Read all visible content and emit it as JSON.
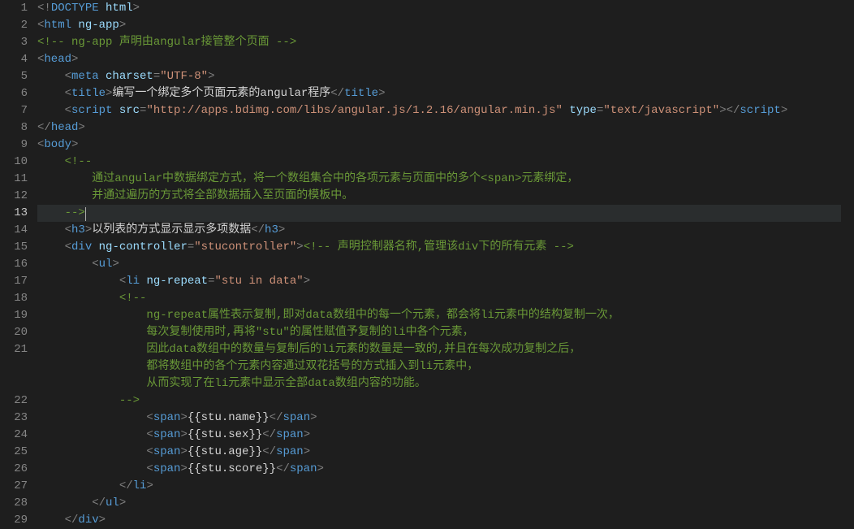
{
  "active_line": 13,
  "lines": [
    {
      "n": 1,
      "indent": 0,
      "tokens": [
        {
          "c": "p-delim",
          "t": "<!"
        },
        {
          "c": "p-tag",
          "t": "DOCTYPE"
        },
        {
          "c": "p-attr",
          "t": " html"
        },
        {
          "c": "p-delim",
          "t": ">"
        }
      ]
    },
    {
      "n": 2,
      "indent": 0,
      "tokens": [
        {
          "c": "p-delim",
          "t": "<"
        },
        {
          "c": "p-tag",
          "t": "html"
        },
        {
          "c": "p-attr",
          "t": " ng-app"
        },
        {
          "c": "p-delim",
          "t": ">"
        }
      ]
    },
    {
      "n": 3,
      "indent": 0,
      "tokens": [
        {
          "c": "p-comment",
          "t": "<!-- ng-app 声明由angular接管整个页面 -->"
        }
      ]
    },
    {
      "n": 4,
      "indent": 0,
      "tokens": [
        {
          "c": "p-delim",
          "t": "<"
        },
        {
          "c": "p-tag",
          "t": "head"
        },
        {
          "c": "p-delim",
          "t": ">"
        }
      ]
    },
    {
      "n": 5,
      "indent": 1,
      "tokens": [
        {
          "c": "p-delim",
          "t": "<"
        },
        {
          "c": "p-tag",
          "t": "meta"
        },
        {
          "c": "p-attr",
          "t": " charset"
        },
        {
          "c": "p-delim",
          "t": "="
        },
        {
          "c": "p-str",
          "t": "\"UTF-8\""
        },
        {
          "c": "p-delim",
          "t": ">"
        }
      ]
    },
    {
      "n": 6,
      "indent": 1,
      "tokens": [
        {
          "c": "p-delim",
          "t": "<"
        },
        {
          "c": "p-tag",
          "t": "title"
        },
        {
          "c": "p-delim",
          "t": ">"
        },
        {
          "c": "p-text",
          "t": "编写一个绑定多个页面元素的angular程序"
        },
        {
          "c": "p-delim",
          "t": "</"
        },
        {
          "c": "p-tag",
          "t": "title"
        },
        {
          "c": "p-delim",
          "t": ">"
        }
      ]
    },
    {
      "n": 7,
      "indent": 1,
      "tokens": [
        {
          "c": "p-delim",
          "t": "<"
        },
        {
          "c": "p-tag",
          "t": "script"
        },
        {
          "c": "p-attr",
          "t": " src"
        },
        {
          "c": "p-delim",
          "t": "="
        },
        {
          "c": "p-str",
          "t": "\"http://apps.bdimg.com/libs/angular.js/1.2.16/angular.min.js\""
        },
        {
          "c": "p-attr",
          "t": " type"
        },
        {
          "c": "p-delim",
          "t": "="
        },
        {
          "c": "p-str",
          "t": "\"text/javascript\""
        },
        {
          "c": "p-delim",
          "t": "></"
        },
        {
          "c": "p-tag",
          "t": "script"
        },
        {
          "c": "p-delim",
          "t": ">"
        }
      ]
    },
    {
      "n": 8,
      "indent": 0,
      "tokens": [
        {
          "c": "p-delim",
          "t": "</"
        },
        {
          "c": "p-tag",
          "t": "head"
        },
        {
          "c": "p-delim",
          "t": ">"
        }
      ]
    },
    {
      "n": 9,
      "indent": 0,
      "tokens": [
        {
          "c": "p-delim",
          "t": "<"
        },
        {
          "c": "p-tag",
          "t": "body"
        },
        {
          "c": "p-delim",
          "t": ">"
        }
      ]
    },
    {
      "n": 10,
      "indent": 1,
      "tokens": [
        {
          "c": "p-comment",
          "t": "<!--"
        }
      ]
    },
    {
      "n": 11,
      "indent": 2,
      "tokens": [
        {
          "c": "p-comment",
          "t": "通过angular中数据绑定方式，将一个数组集合中的各项元素与页面中的多个<span>元素绑定，"
        }
      ]
    },
    {
      "n": 12,
      "indent": 2,
      "tokens": [
        {
          "c": "p-comment",
          "t": "并通过遍历的方式将全部数据插入至页面的模板中。"
        }
      ]
    },
    {
      "n": 13,
      "indent": 1,
      "cursor": true,
      "tokens": [
        {
          "c": "p-comment",
          "t": "-->"
        }
      ]
    },
    {
      "n": 14,
      "indent": 1,
      "tokens": [
        {
          "c": "p-delim",
          "t": "<"
        },
        {
          "c": "p-tag",
          "t": "h3"
        },
        {
          "c": "p-delim",
          "t": ">"
        },
        {
          "c": "p-text",
          "t": "以列表的方式显示显示多项数据"
        },
        {
          "c": "p-delim",
          "t": "</"
        },
        {
          "c": "p-tag",
          "t": "h3"
        },
        {
          "c": "p-delim",
          "t": ">"
        }
      ]
    },
    {
      "n": 15,
      "indent": 1,
      "tokens": [
        {
          "c": "p-delim",
          "t": "<"
        },
        {
          "c": "p-tag",
          "t": "div"
        },
        {
          "c": "p-attr",
          "t": " ng-controller"
        },
        {
          "c": "p-delim",
          "t": "="
        },
        {
          "c": "p-str",
          "t": "\"stucontroller\""
        },
        {
          "c": "p-delim",
          "t": ">"
        },
        {
          "c": "p-comment",
          "t": "<!-- 声明控制器名称,管理该div下的所有元素 -->"
        }
      ]
    },
    {
      "n": 16,
      "indent": 2,
      "tokens": [
        {
          "c": "p-delim",
          "t": "<"
        },
        {
          "c": "p-tag",
          "t": "ul"
        },
        {
          "c": "p-delim",
          "t": ">"
        }
      ]
    },
    {
      "n": 17,
      "indent": 3,
      "tokens": [
        {
          "c": "p-delim",
          "t": "<"
        },
        {
          "c": "p-tag",
          "t": "li"
        },
        {
          "c": "p-attr",
          "t": " ng-repeat"
        },
        {
          "c": "p-delim",
          "t": "="
        },
        {
          "c": "p-str",
          "t": "\"stu in data\""
        },
        {
          "c": "p-delim",
          "t": ">"
        }
      ]
    },
    {
      "n": 18,
      "indent": 3,
      "tokens": [
        {
          "c": "p-comment",
          "t": "<!--"
        }
      ]
    },
    {
      "n": 19,
      "indent": 4,
      "tokens": [
        {
          "c": "p-comment",
          "t": "ng-repeat属性表示复制,即对data数组中的每一个元素，都会将li元素中的结构复制一次，"
        }
      ]
    },
    {
      "n": 20,
      "indent": 4,
      "tokens": [
        {
          "c": "p-comment",
          "t": "每次复制使用时,再将\"stu\"的属性赋值予复制的li中各个元素，"
        }
      ]
    },
    {
      "n": 21,
      "indent": 4,
      "tokens": [
        {
          "c": "p-comment",
          "t": "因此data数组中的数量与复制后的li元素的数量是一致的,并且在每次成功复制之后，"
        }
      ]
    },
    {
      "n": 21,
      "sub": "b",
      "indent": 4,
      "tokens": [
        {
          "c": "p-comment",
          "t": "都将数组中的各个元素内容通过双花括号的方式插入到li元素中，"
        }
      ]
    },
    {
      "n": 21,
      "sub": "c",
      "indent": 4,
      "tokens": [
        {
          "c": "p-comment",
          "t": "从而实现了在li元素中显示全部data数组内容的功能。"
        }
      ]
    },
    {
      "n": 22,
      "indent": 3,
      "tokens": [
        {
          "c": "p-comment",
          "t": "-->"
        }
      ]
    },
    {
      "n": 23,
      "indent": 4,
      "tokens": [
        {
          "c": "p-delim",
          "t": "<"
        },
        {
          "c": "p-tag",
          "t": "span"
        },
        {
          "c": "p-delim",
          "t": ">"
        },
        {
          "c": "p-text",
          "t": "{{stu.name}}"
        },
        {
          "c": "p-delim",
          "t": "</"
        },
        {
          "c": "p-tag",
          "t": "span"
        },
        {
          "c": "p-delim",
          "t": ">"
        }
      ]
    },
    {
      "n": 24,
      "indent": 4,
      "tokens": [
        {
          "c": "p-delim",
          "t": "<"
        },
        {
          "c": "p-tag",
          "t": "span"
        },
        {
          "c": "p-delim",
          "t": ">"
        },
        {
          "c": "p-text",
          "t": "{{stu.sex}}"
        },
        {
          "c": "p-delim",
          "t": "</"
        },
        {
          "c": "p-tag",
          "t": "span"
        },
        {
          "c": "p-delim",
          "t": ">"
        }
      ]
    },
    {
      "n": 25,
      "indent": 4,
      "tokens": [
        {
          "c": "p-delim",
          "t": "<"
        },
        {
          "c": "p-tag",
          "t": "span"
        },
        {
          "c": "p-delim",
          "t": ">"
        },
        {
          "c": "p-text",
          "t": "{{stu.age}}"
        },
        {
          "c": "p-delim",
          "t": "</"
        },
        {
          "c": "p-tag",
          "t": "span"
        },
        {
          "c": "p-delim",
          "t": ">"
        }
      ]
    },
    {
      "n": 26,
      "indent": 4,
      "tokens": [
        {
          "c": "p-delim",
          "t": "<"
        },
        {
          "c": "p-tag",
          "t": "span"
        },
        {
          "c": "p-delim",
          "t": ">"
        },
        {
          "c": "p-text",
          "t": "{{stu.score}}"
        },
        {
          "c": "p-delim",
          "t": "</"
        },
        {
          "c": "p-tag",
          "t": "span"
        },
        {
          "c": "p-delim",
          "t": ">"
        }
      ]
    },
    {
      "n": 27,
      "indent": 3,
      "tokens": [
        {
          "c": "p-delim",
          "t": "</"
        },
        {
          "c": "p-tag",
          "t": "li"
        },
        {
          "c": "p-delim",
          "t": ">"
        }
      ]
    },
    {
      "n": 28,
      "indent": 2,
      "tokens": [
        {
          "c": "p-delim",
          "t": "</"
        },
        {
          "c": "p-tag",
          "t": "ul"
        },
        {
          "c": "p-delim",
          "t": ">"
        }
      ]
    },
    {
      "n": 29,
      "indent": 1,
      "tokens": [
        {
          "c": "p-delim",
          "t": "</"
        },
        {
          "c": "p-tag",
          "t": "div"
        },
        {
          "c": "p-delim",
          "t": ">"
        }
      ]
    }
  ]
}
